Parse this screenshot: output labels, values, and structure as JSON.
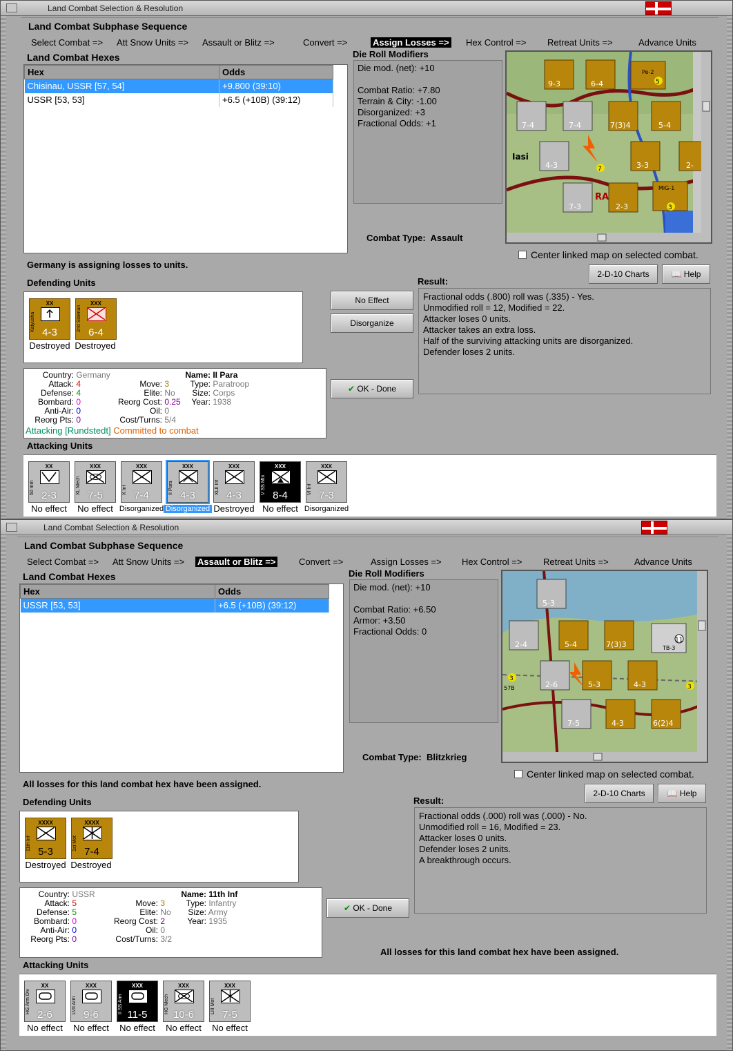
{
  "windows": [
    {
      "title": "Land Combat Selection & Resolution",
      "sequence_title": "Land Combat Subphase Sequence",
      "sequence": [
        "Select Combat =>",
        "Att Snow Units =>",
        "Assault or Blitz =>",
        "Convert =>",
        "Assign Losses =>",
        "Hex Control =>",
        "Retreat Units =>",
        "Advance Units"
      ],
      "active_step": 4,
      "hexes_label": "Land Combat Hexes",
      "columns": [
        "Hex",
        "Odds"
      ],
      "rows": [
        {
          "hex": "Chisinau, USSR [57, 54]",
          "odds": "+9.800 (39:10)",
          "selected": true
        },
        {
          "hex": "USSR [53, 53]",
          "odds": "+6.5 (+10B) (39:12)",
          "selected": false
        }
      ],
      "drm_label": "Die Roll Modifiers",
      "drm": [
        "Die mod. (net): +10",
        "",
        "Combat Ratio: +7.80",
        "Terrain & City: -1.00",
        "Disorganized: +3",
        "Fractional Odds: +1"
      ],
      "combat_type_label": "Combat Type:",
      "combat_type": "Assault",
      "center_map": "Center linked map on selected combat.",
      "status": "Germany is assigning losses to units.",
      "defending_label": "Defending Units",
      "defenders": [
        {
          "tag": "XX",
          "name": "Katyusha",
          "val": "4-3",
          "caption": "Destroyed"
        },
        {
          "tag": "XXX",
          "name": "2nd Siberian",
          "val": "6-4",
          "caption": "Destroyed"
        }
      ],
      "btn_no_effect": "No Effect",
      "btn_disorganize": "Disorganize",
      "btn_ok": "OK - Done",
      "btn_charts": "2-D-10 Charts",
      "btn_help": "Help",
      "result_label": "Result:",
      "result": [
        "Fractional odds (.800) roll was (.335)  - Yes.",
        "Unmodified roll = 12, Modified = 22.",
        "Attacker loses 0 units.",
        "Attacker takes an extra loss.",
        "Half of the surviving attacking units are disorganized.",
        "Defender loses 2 units."
      ],
      "info": {
        "country_k": "Country:",
        "country": "Germany",
        "attack_k": "Attack:",
        "attack": "4",
        "defense_k": "Defense:",
        "defense": "4",
        "bombard_k": "Bombard:",
        "bombard": "0",
        "antiair_k": "Anti-Air:",
        "antiair": "0",
        "reorgpts_k": "Reorg Pts:",
        "reorgpts": "0",
        "move_k": "Move:",
        "move": "3",
        "elite_k": "Elite:",
        "elite": "No",
        "reorgcost_k": "Reorg Cost:",
        "reorgcost": "0.25",
        "oil_k": "Oil:",
        "oil": "0",
        "costturns_k": "Cost/Turns:",
        "costturns": "5/4",
        "name_k": "Name:",
        "name": "II Para",
        "type_k": "Type:",
        "type": "Paratroop",
        "size_k": "Size:",
        "size": "Corps",
        "year_k": "Year:",
        "year": "1938",
        "attacking": "Attacking [Rundstedt]",
        "committed": "Committed to combat"
      },
      "attacking_label": "Attacking Units",
      "attackers": [
        {
          "tag": "XX",
          "name": "50 mm",
          "val": "2-3",
          "caption": "No effect"
        },
        {
          "tag": "XXX",
          "name": "XL Mech",
          "val": "7-5",
          "caption": "No effect"
        },
        {
          "tag": "XXX",
          "name": "X Inf",
          "val": "7-4",
          "caption": "Disorganized"
        },
        {
          "tag": "XXX",
          "name": "II Para",
          "val": "4-3",
          "caption": "Disorganized"
        },
        {
          "tag": "XXX",
          "name": "XLII Inf",
          "val": "4-3",
          "caption": "Destroyed"
        },
        {
          "tag": "XXX",
          "name": "V SS Mtn",
          "val": "8-4",
          "caption": "No effect"
        },
        {
          "tag": "XXX",
          "name": "VI Inf",
          "val": "7-3",
          "caption": "Disorganized"
        }
      ],
      "map_labels": [
        "Iasi",
        "RA",
        "9-3",
        "6-4",
        "7-4",
        "7-4",
        "7(3)4",
        "5-4",
        "4-3",
        "3-3",
        "2-",
        "7-3",
        "2-3",
        "5",
        "7",
        "3",
        "Pe-2",
        "MiG-1"
      ]
    },
    {
      "title": "Land Combat Selection & Resolution",
      "sequence_title": "Land Combat Subphase Sequence",
      "sequence": [
        "Select Combat =>",
        "Att Snow Units =>",
        "Assault or Blitz =>",
        "Convert =>",
        "Assign Losses =>",
        "Hex Control =>",
        "Retreat Units =>",
        "Advance Units"
      ],
      "active_step": 2,
      "hexes_label": "Land Combat Hexes",
      "columns": [
        "Hex",
        "Odds"
      ],
      "rows": [
        {
          "hex": "USSR [53, 53]",
          "odds": "+6.5 (+10B) (39:12)",
          "selected": true
        }
      ],
      "drm_label": "Die Roll Modifiers",
      "drm": [
        "Die mod. (net): +10",
        "",
        "Combat Ratio: +6.50",
        "Armor: +3.50",
        "Fractional Odds: 0"
      ],
      "combat_type_label": "Combat Type:",
      "combat_type": "Blitzkrieg",
      "center_map": "Center linked map on selected combat.",
      "status": "All losses for this land combat hex have been assigned.",
      "defending_label": "Defending Units",
      "defenders": [
        {
          "tag": "XXXX",
          "name": "11th Inf",
          "val": "5-3",
          "caption": "Destroyed"
        },
        {
          "tag": "XXXX",
          "name": "1st Mot",
          "val": "7-4",
          "caption": "Destroyed"
        }
      ],
      "btn_ok": "OK - Done",
      "btn_charts": "2-D-10 Charts",
      "btn_help": "Help",
      "result_label": "Result:",
      "result": [
        "Fractional odds (.000) roll was (.000)  - No.",
        "Unmodified roll = 16, Modified = 23.",
        "Attacker loses 0 units.",
        "Defender loses 2 units.",
        "A breakthrough occurs."
      ],
      "bottom_status": "All losses for this land combat hex have been assigned.",
      "info": {
        "country_k": "Country:",
        "country": "USSR",
        "attack_k": "Attack:",
        "attack": "5",
        "defense_k": "Defense:",
        "defense": "5",
        "bombard_k": "Bombard:",
        "bombard": "0",
        "antiair_k": "Anti-Air:",
        "antiair": "0",
        "reorgpts_k": "Reorg Pts:",
        "reorgpts": "0",
        "move_k": "Move:",
        "move": "3",
        "elite_k": "Elite:",
        "elite": "No",
        "reorgcost_k": "Reorg Cost:",
        "reorgcost": "2",
        "oil_k": "Oil:",
        "oil": "0",
        "costturns_k": "Cost/Turns:",
        "costturns": "3/2",
        "name_k": "Name:",
        "name": "11th Inf",
        "type_k": "Type:",
        "type": "Infantry",
        "size_k": "Size:",
        "size": "Army",
        "year_k": "Year:",
        "year": "1935"
      },
      "attacking_label": "Attacking Units",
      "attackers": [
        {
          "tag": "XX",
          "name": "HG Arm Div",
          "val": "2-6",
          "caption": "No effect"
        },
        {
          "tag": "XXX",
          "name": "LVII Arm",
          "val": "9-6",
          "caption": "No effect"
        },
        {
          "tag": "XXX",
          "name": "II SS Arm",
          "val": "11-5",
          "caption": "No effect"
        },
        {
          "tag": "XXX",
          "name": "HG Mech",
          "val": "10-6",
          "caption": "No effect"
        },
        {
          "tag": "XXX",
          "name": "LIII Mot",
          "val": "7-5",
          "caption": "No effect"
        }
      ],
      "map_labels": [
        "5-3",
        "2-4",
        "5-4",
        "7(3)3",
        "2-6",
        "5-3",
        "4-3",
        "7-5",
        "4-3",
        "6(2)4",
        "11",
        "3",
        "3",
        "TB-3",
        "57B"
      ]
    }
  ],
  "colors": {
    "highlight": "#3399ff",
    "window": "#a9a9a9",
    "german_counter": "#bdbdbd",
    "soviet_counter": "#b8860b"
  }
}
